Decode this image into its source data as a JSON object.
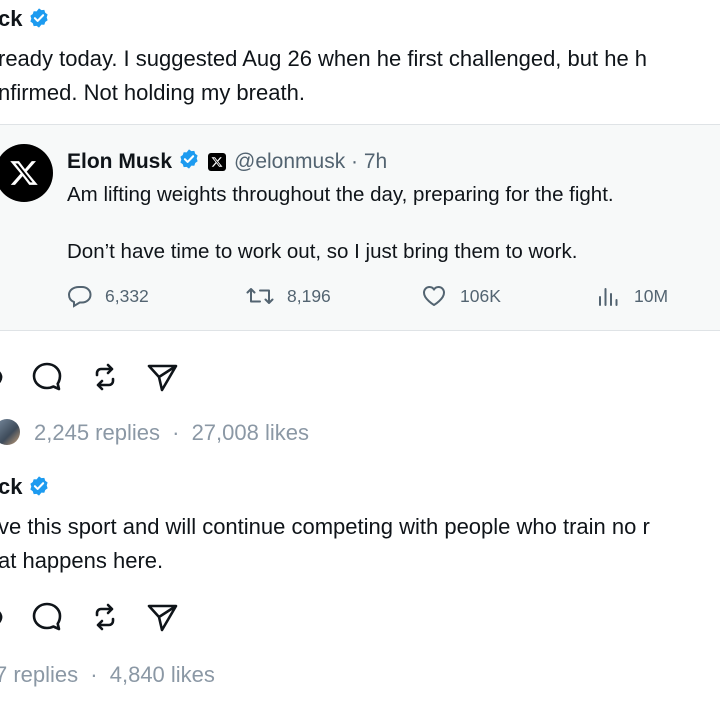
{
  "post1": {
    "author_fragment": "ck",
    "text_line1": " ready today. I suggested Aug 26 when he first challenged, but he h",
    "text_line2": "nfirmed. Not holding my breath."
  },
  "quoted_post": {
    "author": "Elon Musk",
    "handle_time": "@elonmusk · 7h",
    "text_line1": "Am lifting weights throughout the day, preparing for the fight.",
    "text_line2": "Don’t have time to work out, so I just bring them to work.",
    "stats": {
      "replies": "6,332",
      "reposts": "8,196",
      "likes": "106K",
      "views": "10M"
    }
  },
  "post1_footer": {
    "replies": "2,245 replies",
    "separator": "·",
    "likes": "27,008 likes"
  },
  "post2": {
    "author_fragment": "ck",
    "text_line1": "ve this sport and will continue competing with people who train no r",
    "text_line2": "at happens here."
  },
  "post2_footer": {
    "replies": "7 replies",
    "separator": "·",
    "likes": "4,840 likes"
  },
  "colors": {
    "verified_blue": "#1d9bf0",
    "muted": "#8b98a5",
    "stat_gray": "#536471",
    "quote_bg": "#f7f9f9"
  },
  "icons": [
    "verified-badge-icon",
    "x-logo-icon",
    "heart-icon",
    "comment-icon",
    "repost-icon",
    "share-icon",
    "views-icon"
  ]
}
